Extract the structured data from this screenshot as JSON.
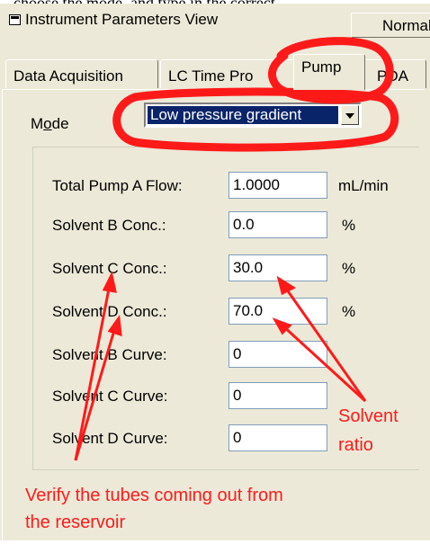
{
  "window": {
    "title": "Instrument Parameters View",
    "mode_button_label": "Normal"
  },
  "tabs": [
    {
      "label": "Data Acquisition"
    },
    {
      "label": "LC Time Pro"
    },
    {
      "label": "Pump"
    },
    {
      "label": "PDA"
    }
  ],
  "active_tab": "Pump",
  "mode": {
    "label": "Mode",
    "value": "Low pressure gradient"
  },
  "params": [
    {
      "label": "Total Pump A Flow:",
      "value": "1.0000",
      "unit": "mL/min"
    },
    {
      "label": "Solvent B Conc.:",
      "value": "0.0",
      "unit": "%"
    },
    {
      "label": "Solvent C Conc.:",
      "value": "30.0",
      "unit": "%"
    },
    {
      "label": "Solvent D Conc.:",
      "value": "70.0",
      "unit": "%"
    },
    {
      "label": "Solvent B Curve:",
      "value": "0",
      "unit": ""
    },
    {
      "label": "Solvent C Curve:",
      "value": "0",
      "unit": ""
    },
    {
      "label": "Solvent D Curve:",
      "value": "0",
      "unit": ""
    }
  ],
  "annotations": {
    "solvent_ratio": "Solvent ratio",
    "solvent_ratio_line1": "Solvent",
    "solvent_ratio_line2": "ratio",
    "verify_line1": "Verify the tubes coming out from",
    "verify_line2": "the reservoir"
  },
  "colors": {
    "annotation": "#ff1a1a",
    "selection": "#0a246a",
    "dialog_bg": "#ece9d8"
  }
}
